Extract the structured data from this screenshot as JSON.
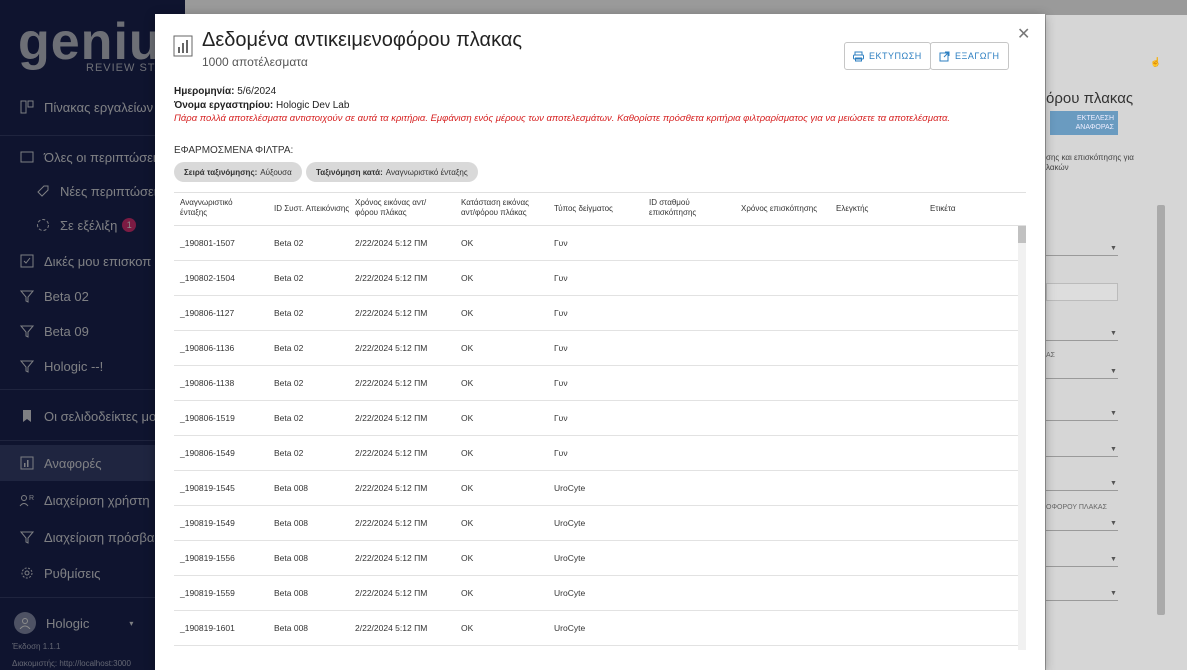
{
  "sidebar": {
    "logo": "genius",
    "logo_sub": "REVIEW STATIO",
    "items": [
      {
        "label": "Πίνακας εργαλείων",
        "icon": "dashboard-icon"
      },
      {
        "label": "Όλες οι περιπτώσεις",
        "icon": "folder-icon"
      },
      {
        "label": "Νέες περιπτώσεις",
        "icon": "tag-icon"
      },
      {
        "label": "Σε εξέλιξη",
        "icon": "spinner-icon",
        "badge": "1"
      },
      {
        "label": "Δικές μου επισκοπ",
        "icon": "checkbox-icon"
      },
      {
        "label": "Beta 02",
        "icon": "filter-icon"
      },
      {
        "label": "Beta 09",
        "icon": "filter-icon"
      },
      {
        "label": "Hologic --!",
        "icon": "filter-icon"
      },
      {
        "label": "Οι σελιδοδείκτες μου",
        "icon": "bookmark-icon"
      },
      {
        "label": "Αναφορές",
        "icon": "reports-icon"
      },
      {
        "label": "Διαχείριση χρήστη",
        "icon": "users-icon"
      },
      {
        "label": "Διαχείριση πρόσβαση",
        "icon": "access-icon"
      },
      {
        "label": "Ρυθμίσεις",
        "icon": "gear-icon"
      }
    ],
    "user": "Hologic",
    "version": "Έκδοση 1.1.1",
    "server": "Διακομιστής: http://localhost:3000"
  },
  "background": {
    "title": "όρου πλακας",
    "run_button": "ΕΚΤΕΛΕΣΗ ΑΝΑΦΟΡΑΣ",
    "desc_line1": "σης και επισκόπησης για",
    "desc_line2": "λακών",
    "label_a": "ΑΣ",
    "label_b": "ΟΦΟΡΟΥ ΠΛΑΚΑΣ"
  },
  "modal": {
    "title": "Δεδομένα αντικειμενοφόρου πλακας",
    "subtitle": "1000 αποτέλεσματα",
    "print_label": "ΕΚΤΥΠΩΣΗ",
    "export_label": "ΕΞΑΓΩΓΗ",
    "date_label": "Ημερομηνία:",
    "date_value": "5/6/2024",
    "lab_label": "Όνομα εργαστηρίου:",
    "lab_value": "Hologic Dev Lab",
    "warning": "Πάρα πολλά αποτελέσματα αντιστοιχούν σε αυτά τα κριτήρια. Εμφάνιση ενός μέρους των αποτελεσμάτων. Καθορίστε πρόσθετα κριτήρια φιλτραρίσματος για να μειώσετε τα αποτελέσματα.",
    "filters_label": "ΕΦΑΡΜΟΣΜΕΝΑ ΦΙΛΤΡΑ:",
    "chips": [
      {
        "key": "Σειρά ταξινόμησης:",
        "value": "Αύξουσα"
      },
      {
        "key": "Ταξινόμηση κατά:",
        "value": "Αναγνωριστικό ένταξης"
      }
    ]
  },
  "table": {
    "headers": [
      [
        "Αναγνωριστικό",
        "ένταξης"
      ],
      [
        "ID Συστ. Απεικόνισης"
      ],
      [
        "Χρόνος εικόνας αντ/",
        "φόρου πλάκας"
      ],
      [
        "Κατάσταση εικόνας",
        "αντ/φόρου πλάκας"
      ],
      [
        "Τύπος δείγματος"
      ],
      [
        "ID σταθμού",
        "επισκόπησης"
      ],
      [
        "Χρόνος επισκόπησης"
      ],
      [
        "Ελεγκτής"
      ],
      [
        "Ετικέτα"
      ]
    ],
    "rows": [
      [
        "_190801-1507",
        "Beta 02",
        "2/22/2024 5:12 ΠΜ",
        "OK",
        "Γυν"
      ],
      [
        "_190802-1504",
        "Beta 02",
        "2/22/2024 5:12 ΠΜ",
        "OK",
        "Γυν"
      ],
      [
        "_190806-1127",
        "Beta 02",
        "2/22/2024 5:12 ΠΜ",
        "OK",
        "Γυν"
      ],
      [
        "_190806-1136",
        "Beta 02",
        "2/22/2024 5:12 ΠΜ",
        "OK",
        "Γυν"
      ],
      [
        "_190806-1138",
        "Beta 02",
        "2/22/2024 5:12 ΠΜ",
        "OK",
        "Γυν"
      ],
      [
        "_190806-1519",
        "Beta 02",
        "2/22/2024 5:12 ΠΜ",
        "OK",
        "Γυν"
      ],
      [
        "_190806-1549",
        "Beta 02",
        "2/22/2024 5:12 ΠΜ",
        "OK",
        "Γυν"
      ],
      [
        "_190819-1545",
        "Beta 008",
        "2/22/2024 5:12 ΠΜ",
        "OK",
        "UroCyte"
      ],
      [
        "_190819-1549",
        "Beta 008",
        "2/22/2024 5:12 ΠΜ",
        "OK",
        "UroCyte"
      ],
      [
        "_190819-1556",
        "Beta 008",
        "2/22/2024 5:12 ΠΜ",
        "OK",
        "UroCyte"
      ],
      [
        "_190819-1559",
        "Beta 008",
        "2/22/2024 5:12 ΠΜ",
        "OK",
        "UroCyte"
      ],
      [
        "_190819-1601",
        "Beta 008",
        "2/22/2024 5:12 ΠΜ",
        "OK",
        "UroCyte"
      ]
    ]
  },
  "colors": {
    "sidebar_bg": "#1d2656",
    "accent": "#2d7fc1",
    "warning": "#d62020",
    "badge": "#e2327a"
  }
}
